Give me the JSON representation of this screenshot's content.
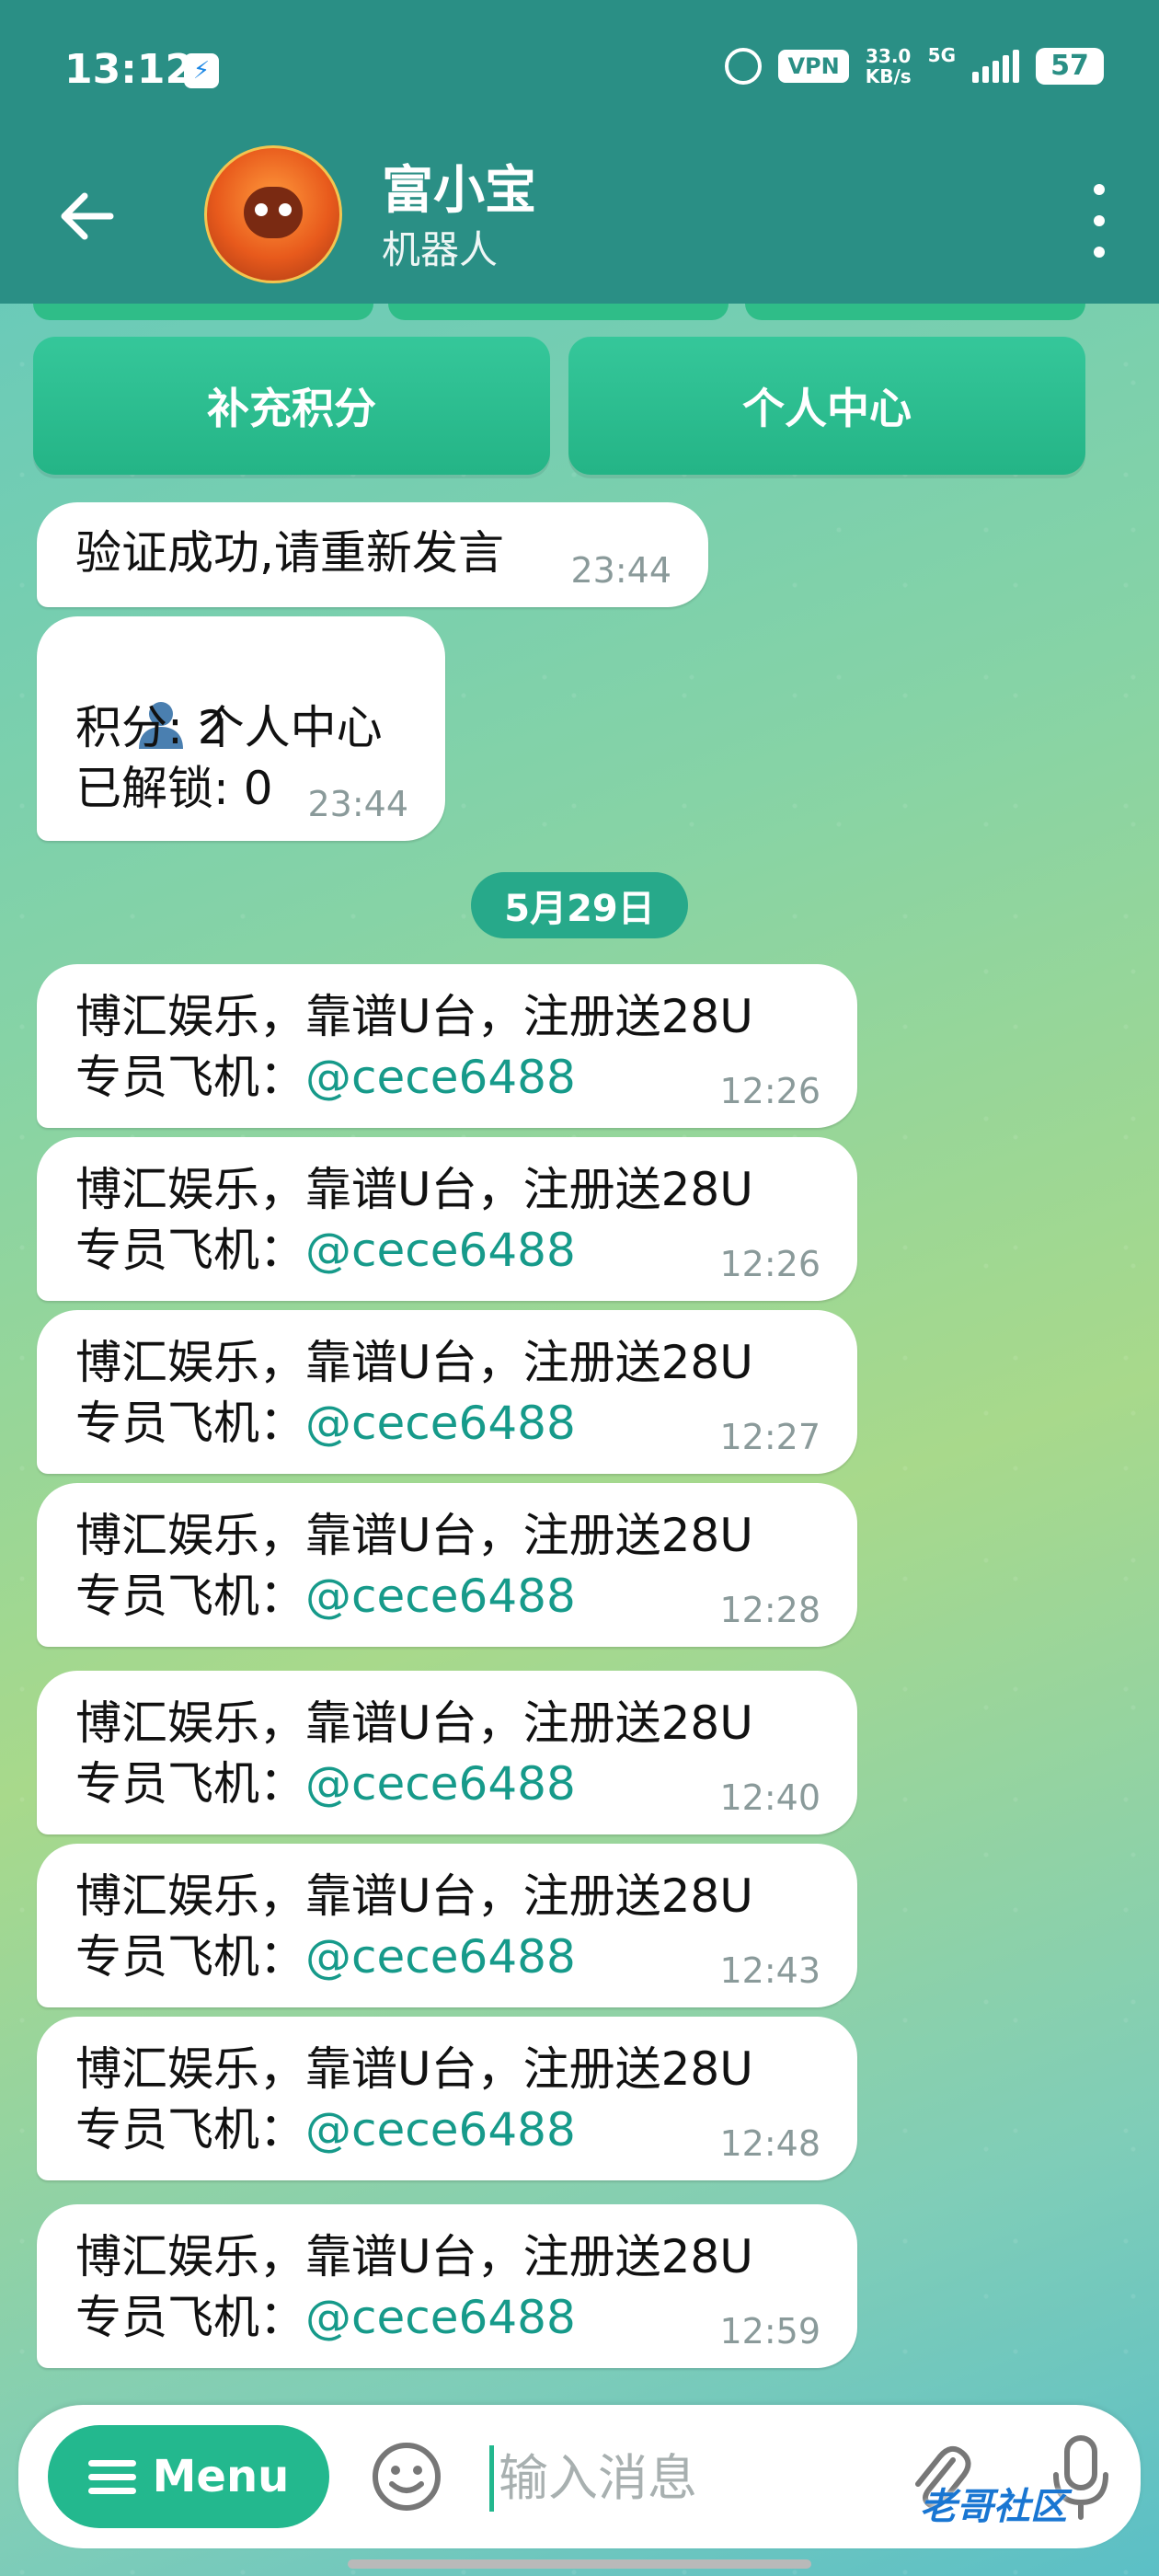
{
  "status_bar": {
    "time": "13:12",
    "vpn": "VPN",
    "net_speed_value": "33.0",
    "net_speed_unit": "KB/s",
    "network": "5G",
    "battery": "57"
  },
  "header": {
    "title": "富小宝",
    "subtitle": "机器人"
  },
  "keyboard": {
    "buttons": [
      {
        "label": "补充积分"
      },
      {
        "label": "个人中心"
      }
    ]
  },
  "messages_before": [
    {
      "text": "验证成功,请重新发言",
      "time": "23:44"
    },
    {
      "lines": [
        "个人中心",
        "积分: 2",
        "已解锁: 0"
      ],
      "time": "23:44"
    }
  ],
  "date_divider": "5月29日",
  "ad_messages": [
    {
      "line1": "博汇娱乐，靠谱U台，注册送28U",
      "prefix": "专员飞机：",
      "handle": "@cece6488",
      "time": "12:26"
    },
    {
      "line1": "博汇娱乐，靠谱U台，注册送28U",
      "prefix": "专员飞机：",
      "handle": "@cece6488",
      "time": "12:26"
    },
    {
      "line1": "博汇娱乐，靠谱U台，注册送28U",
      "prefix": "专员飞机：",
      "handle": "@cece6488",
      "time": "12:27"
    },
    {
      "line1": "博汇娱乐，靠谱U台，注册送28U",
      "prefix": "专员飞机：",
      "handle": "@cece6488",
      "time": "12:28"
    },
    {
      "line1": "博汇娱乐，靠谱U台，注册送28U",
      "prefix": "专员飞机：",
      "handle": "@cece6488",
      "time": "12:40"
    },
    {
      "line1": "博汇娱乐，靠谱U台，注册送28U",
      "prefix": "专员飞机：",
      "handle": "@cece6488",
      "time": "12:43"
    },
    {
      "line1": "博汇娱乐，靠谱U台，注册送28U",
      "prefix": "专员飞机：",
      "handle": "@cece6488",
      "time": "12:48"
    },
    {
      "line1": "博汇娱乐，靠谱U台，注册送28U",
      "prefix": "专员飞机：",
      "handle": "@cece6488",
      "time": "12:59"
    }
  ],
  "input_bar": {
    "menu_label": "Menu",
    "placeholder": "输入消息"
  },
  "watermark": "老哥社区",
  "colors": {
    "header": "#2a8f85",
    "keyboard_button": "#2fbd88",
    "link": "#169a8a"
  }
}
